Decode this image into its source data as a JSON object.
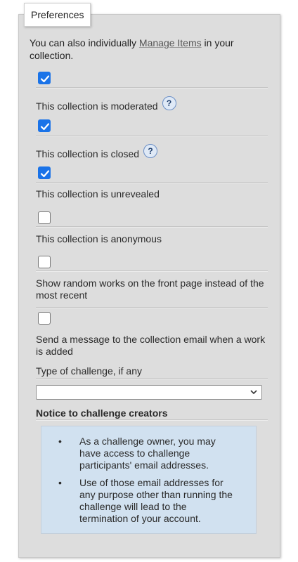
{
  "fieldset": {
    "legend": "Preferences"
  },
  "intro": {
    "before": "You can also individually ",
    "link": "Manage Items",
    "after": " in your collection."
  },
  "options": [
    {
      "label": "This collection is moderated",
      "checked": true,
      "help": "?"
    },
    {
      "label": "This collection is closed",
      "checked": true,
      "help": "?"
    },
    {
      "label": "This collection is unrevealed",
      "checked": true
    },
    {
      "label": "This collection is anonymous",
      "checked": false
    },
    {
      "label": "Show random works on the front page instead of the most recent",
      "checked": false
    },
    {
      "label": "Send a message to the collection email when a work is added",
      "checked": false
    }
  ],
  "challenge": {
    "label": "Type of challenge, if any",
    "value": ""
  },
  "notice": {
    "heading": "Notice to challenge creators",
    "items": [
      "As a challenge owner, you may have access to challenge participants' email addresses.",
      "Use of those email addresses for any purpose other than running the challenge will lead to the termination of your account."
    ],
    "bullet": "•"
  },
  "colors": {
    "checkbox_checked": "#1a73e8",
    "notice_bg": "#d1e1f0",
    "panel_bg": "#dddddd"
  }
}
